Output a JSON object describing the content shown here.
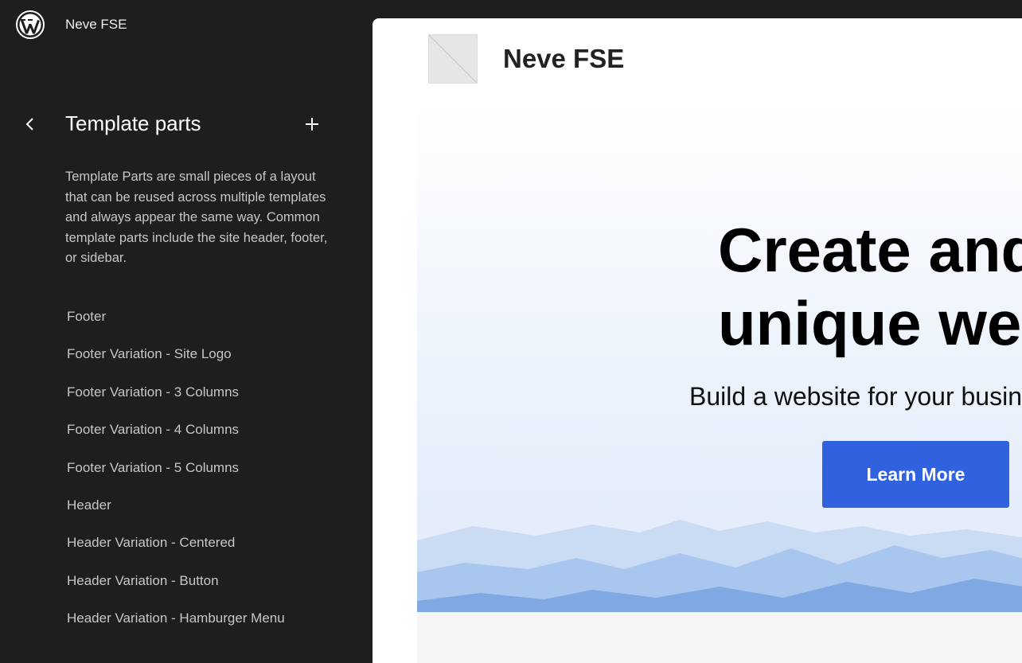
{
  "app": {
    "site_name": "Neve FSE"
  },
  "sidebar": {
    "title": "Template parts",
    "description": "Template Parts are small pieces of a layout that can be reused across multiple templates and always appear the same way. Common template parts include the site header, footer, or sidebar.",
    "items": [
      {
        "label": "Footer"
      },
      {
        "label": "Footer Variation - Site Logo"
      },
      {
        "label": "Footer Variation - 3 Columns"
      },
      {
        "label": "Footer Variation - 4 Columns"
      },
      {
        "label": "Footer Variation - 5 Columns"
      },
      {
        "label": "Header"
      },
      {
        "label": "Header Variation - Centered"
      },
      {
        "label": "Header Variation - Button"
      },
      {
        "label": "Header Variation - Hamburger Menu"
      }
    ]
  },
  "preview": {
    "site_title": "Neve FSE",
    "hero": {
      "heading_line1": "Create and",
      "heading_line2": "unique web",
      "subtitle": "Build a website for your busin",
      "button_label": "Learn More"
    }
  },
  "icons": {
    "logo": "wordpress-logo-icon",
    "back": "chevron-left-icon",
    "add": "plus-icon"
  },
  "colors": {
    "sidebar_bg": "#1e1e1e",
    "accent_button": "#3062e0",
    "text_muted": "#c7c7c7"
  }
}
